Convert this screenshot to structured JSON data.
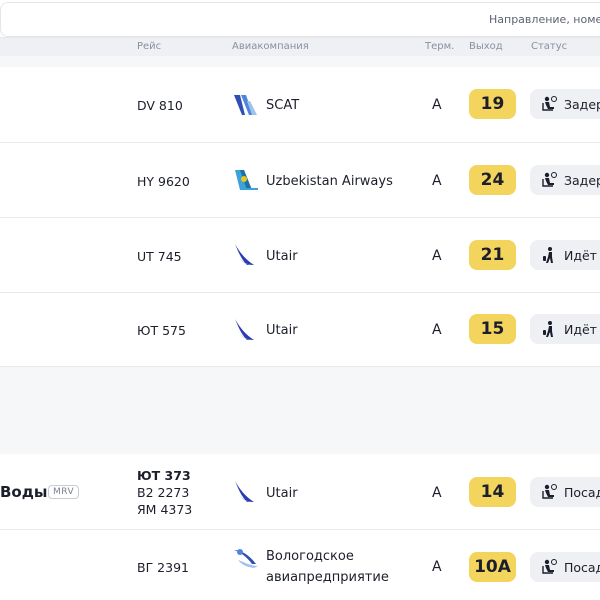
{
  "search": {
    "placeholder": "Направление, номер"
  },
  "table_header": {
    "flight": "Рейс",
    "airline": "Авиакомпания",
    "terminal": "Терм.",
    "gate": "Выход",
    "status": "Статус"
  },
  "rows": [
    {
      "flight": "DV 810",
      "airline": "SCAT",
      "airline_logo": "scat-logo-icon",
      "terminal": "A",
      "gate": "19",
      "status": "Задер",
      "status_icon": "waiting-passenger-icon"
    },
    {
      "flight": "HY 9620",
      "airline": "Uzbekistan Airways",
      "airline_logo": "uzbekistan-airways-logo-icon",
      "terminal": "A",
      "gate": "24",
      "status": "Задер",
      "status_icon": "waiting-passenger-icon"
    },
    {
      "flight": "UT 745",
      "airline": "Utair",
      "airline_logo": "utair-logo-icon",
      "terminal": "A",
      "gate": "21",
      "status": "Идёт",
      "status_icon": "walking-passenger-icon"
    },
    {
      "flight": "ЮТ 575",
      "airline": "Utair",
      "airline_logo": "utair-logo-icon",
      "terminal": "A",
      "gate": "15",
      "status": "Идёт",
      "status_icon": "walking-passenger-icon"
    },
    {
      "city": "Воды",
      "iata": "MRV",
      "flights": [
        "ЮТ 373",
        "В2 2273",
        "ЯМ 4373"
      ],
      "airline": "Utair",
      "airline_logo": "utair-logo-icon",
      "terminal": "A",
      "gate": "14",
      "status": "Посад",
      "status_icon": "waiting-passenger-icon"
    },
    {
      "flight": "ВГ 2391",
      "airline_lines": [
        "Вологодское",
        "авиапредприятие"
      ],
      "airline_logo": "vologda-logo-icon",
      "terminal": "A",
      "gate": "10А",
      "status": "Посад",
      "status_icon": "waiting-passenger-icon"
    }
  ],
  "colors": {
    "gate_badge": "#f3d45c",
    "status_pill": "#eef0f4",
    "utair_blue": "#2a3bb5",
    "scat_blue": "#2f4fb3",
    "uz_teal": "#3aa3d8"
  }
}
